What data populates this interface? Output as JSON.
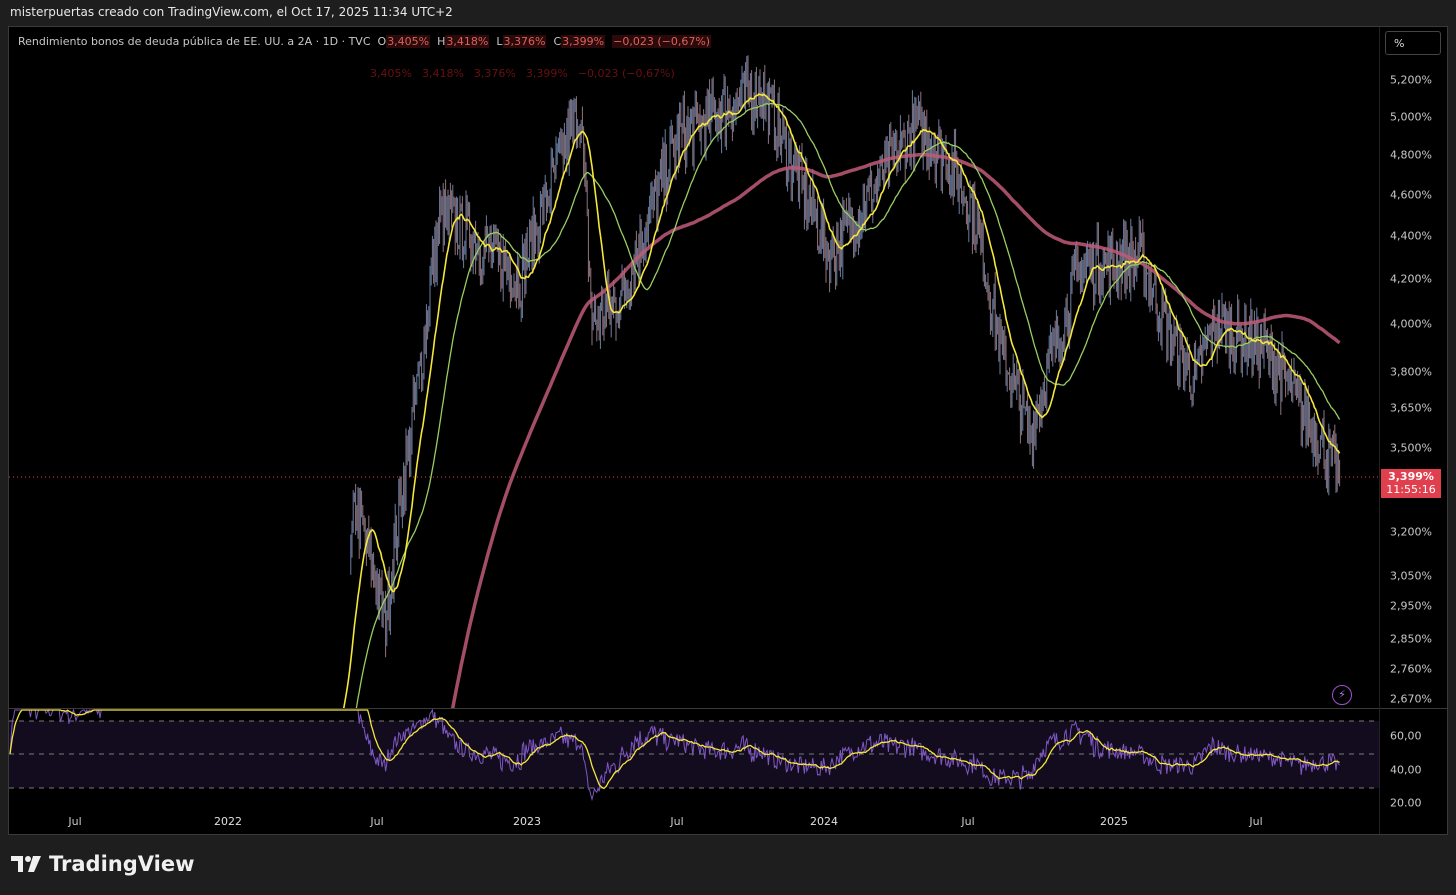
{
  "caption": "misterpuertas creado con TradingView.com, el Oct 17, 2025 11:34 UTC+2",
  "legend": {
    "title": "Rendimiento bonos de deuda pública de EE. UU. a 2A · 1D · TVC",
    "open_label": "O",
    "open": "3,405%",
    "high_label": "H",
    "high": "3,418%",
    "low_label": "L",
    "low": "3,376%",
    "close_label": "C",
    "close": "3,399%",
    "change": "−0,023 (−0,67%)"
  },
  "legend_ghost": [
    "3,405%",
    "3,418%",
    "3,376%",
    "3,399%",
    "−0,023 (−0,67%)"
  ],
  "scale_button": "%",
  "y_axis": [
    "5,200%",
    "5,000%",
    "4,800%",
    "4,600%",
    "4,400%",
    "4,200%",
    "4,000%",
    "3,800%",
    "3,650%",
    "3,500%",
    "3,200%",
    "3,050%",
    "2,950%",
    "2,850%",
    "2,760%",
    "2,670%"
  ],
  "last_price": {
    "value": "3,399%",
    "countdown": "11:55:16"
  },
  "rsi_axis": [
    "60,00",
    "40,00",
    "20.00"
  ],
  "x_axis": [
    "Jul",
    "2022",
    "Jul",
    "2023",
    "Jul",
    "2024",
    "Jul",
    "2025",
    "Jul"
  ],
  "brand": "TradingView",
  "colors": {
    "up": "#26a69a",
    "down": "#ef5350",
    "ma_fast": "#f5e63c",
    "ma_mid": "#9acd62",
    "ma_slow": "#c05a78",
    "rsi": "#7e57c2",
    "last": "#e0404e"
  },
  "chart_data": {
    "type": "line",
    "symbol": "US02Y",
    "timeframe": "1D",
    "scale": "log",
    "ylim": [
      2.67,
      5.2
    ],
    "series_keypoints": {
      "dates": [
        "2022-06",
        "2022-07",
        "2022-09",
        "2022-10",
        "2022-11",
        "2023-01",
        "2023-03",
        "2023-03-15",
        "2023-05",
        "2023-07",
        "2023-10",
        "2023-12",
        "2024-02",
        "2024-04",
        "2024-05",
        "2024-07",
        "2024-08",
        "2024-09",
        "2024-11",
        "2025-01",
        "2025-03",
        "2025-04",
        "2025-05",
        "2025-07",
        "2025-09",
        "2025-10-17"
      ],
      "values": [
        3.3,
        2.9,
        3.8,
        4.5,
        4.4,
        4.2,
        5.05,
        4.0,
        4.1,
        4.9,
        5.15,
        4.3,
        4.6,
        4.95,
        4.8,
        4.5,
        3.9,
        3.55,
        4.25,
        4.3,
        3.95,
        3.75,
        4.0,
        3.9,
        3.6,
        3.399
      ]
    },
    "rsi_levels": [
      70,
      50,
      30
    ]
  }
}
